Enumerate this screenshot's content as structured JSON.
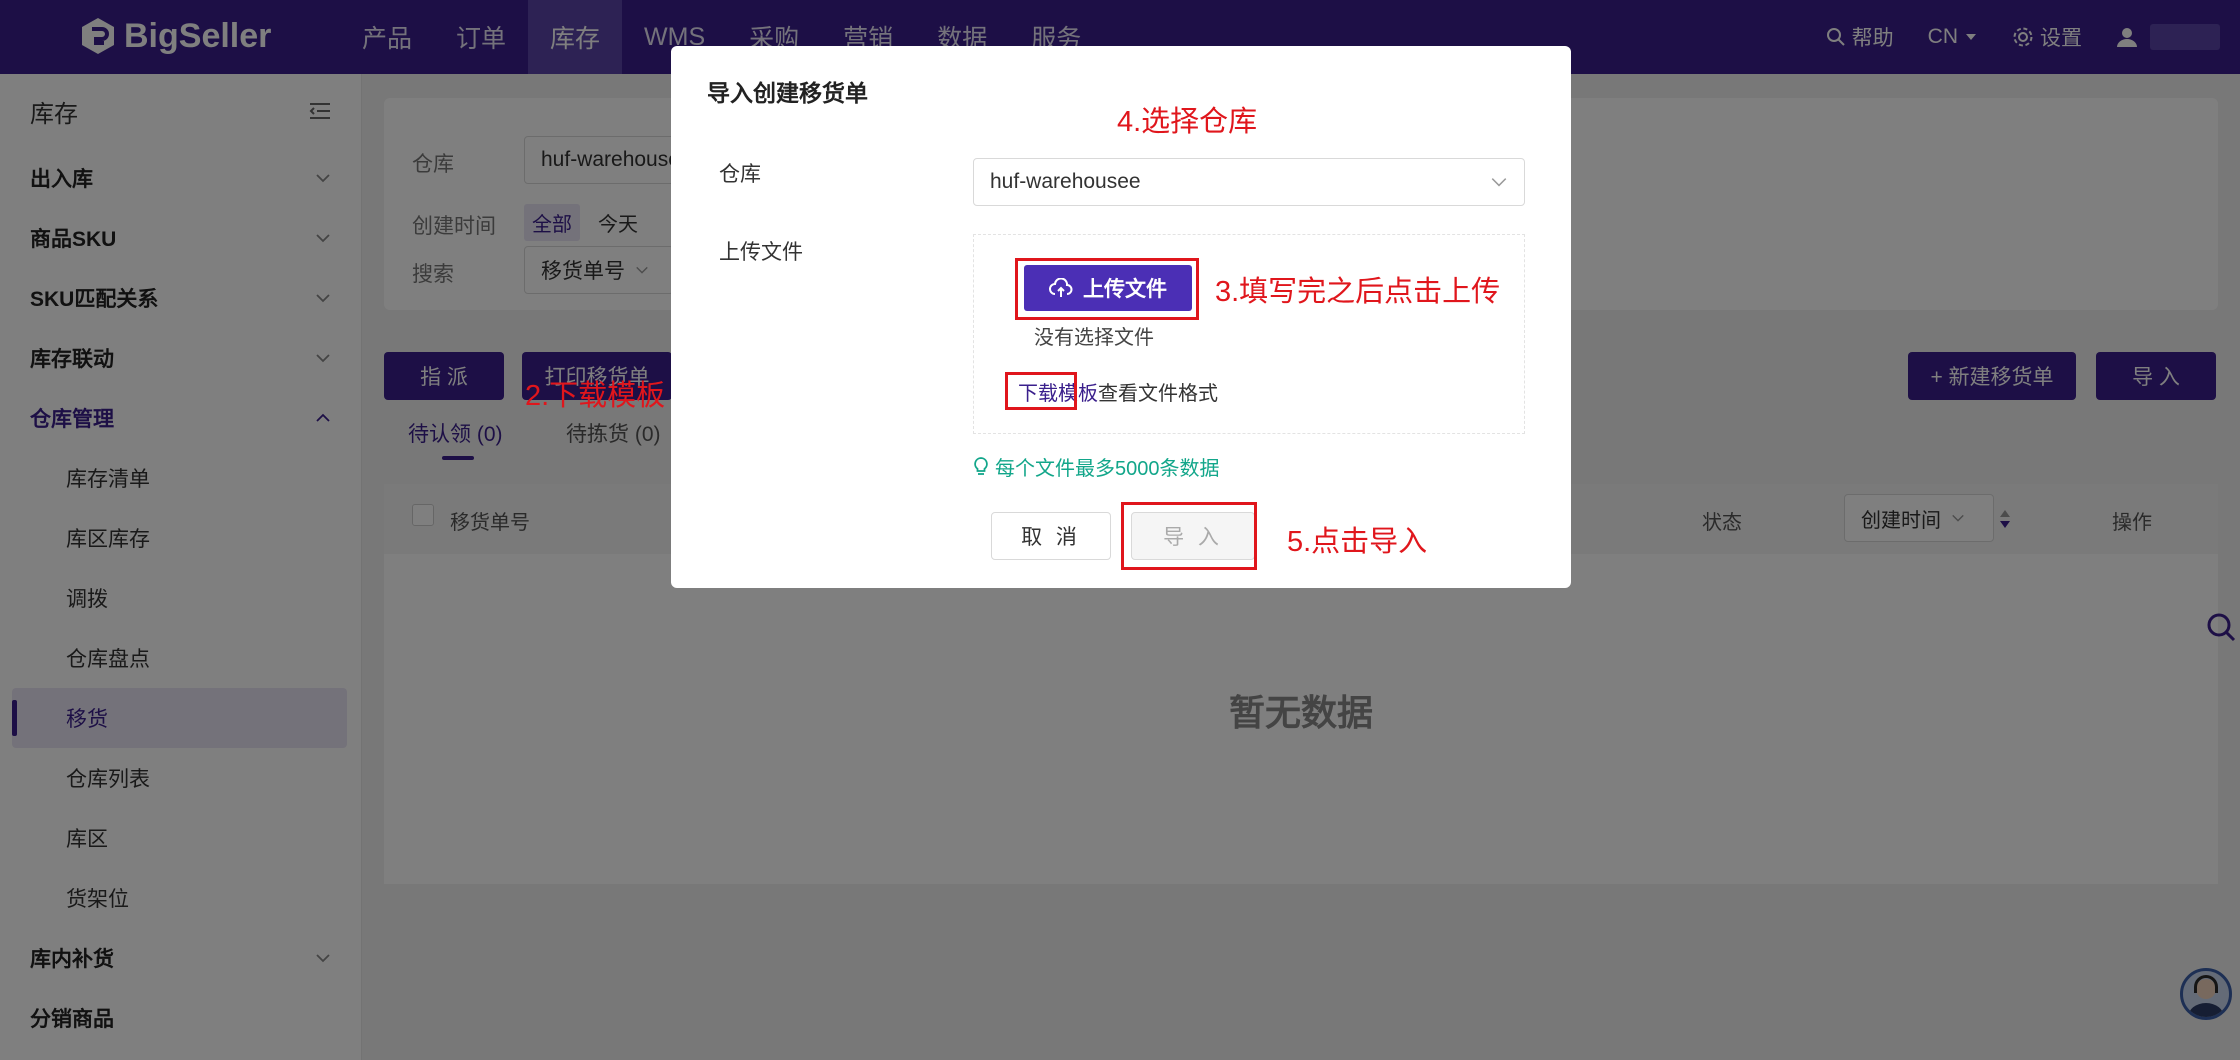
{
  "app": {
    "logo_text": "BigSeller"
  },
  "nav": {
    "items": [
      "产品",
      "订单",
      "库存",
      "WMS",
      "采购",
      "营销",
      "数据",
      "服务"
    ],
    "active_index": 2
  },
  "top_right": {
    "help": "帮助",
    "lang": "CN",
    "settings": "设置"
  },
  "sidebar": {
    "title": "库存",
    "groups": [
      {
        "label": "出入库"
      },
      {
        "label": "商品SKU"
      },
      {
        "label": "SKU匹配关系"
      },
      {
        "label": "库存联动"
      },
      {
        "label": "仓库管理"
      }
    ],
    "warehouse_items": [
      "库存清单",
      "库区库存",
      "调拨",
      "仓库盘点",
      "移货",
      "仓库列表",
      "库区",
      "货架位"
    ],
    "active_item": "移货",
    "groups_after": [
      {
        "label": "库内补货"
      },
      {
        "label": "分销商品"
      }
    ]
  },
  "filters": {
    "warehouse_label": "仓库",
    "warehouse_value": "huf-warehouse",
    "created_label": "创建时间",
    "created_all": "全部",
    "created_today": "今天",
    "search_label": "搜索",
    "search_field": "移货单号"
  },
  "actions": {
    "assign": "指 派",
    "print": "打印移货单",
    "new": "+ 新建移货单",
    "import": "导 入"
  },
  "tabs": [
    {
      "label": "待认领 (0)"
    },
    {
      "label": "待拣货 (0)"
    }
  ],
  "table": {
    "headers": {
      "order_no": "移货单号",
      "status": "状态",
      "created": "创建时间",
      "actions": "操作"
    },
    "empty": "暂无数据"
  },
  "modal": {
    "title": "导入创建移货单",
    "warehouse_label": "仓库",
    "warehouse_value": "huf-warehousee",
    "upload_label": "上传文件",
    "upload_button": "上传文件",
    "no_file": "没有选择文件",
    "download_template": "下载模板",
    "view_format": "查看文件格式",
    "hint": "每个文件最多5000条数据",
    "cancel": "取 消",
    "import": "导 入"
  },
  "annotations": {
    "step2": "2.下载模板",
    "step3": "3.填写完之后点击上传",
    "step4": "4.选择仓库",
    "step5": "5.点击导入"
  },
  "colors": {
    "brand": "#3a1f8c",
    "annotation": "#e0161c",
    "hint": "#12a68a"
  }
}
